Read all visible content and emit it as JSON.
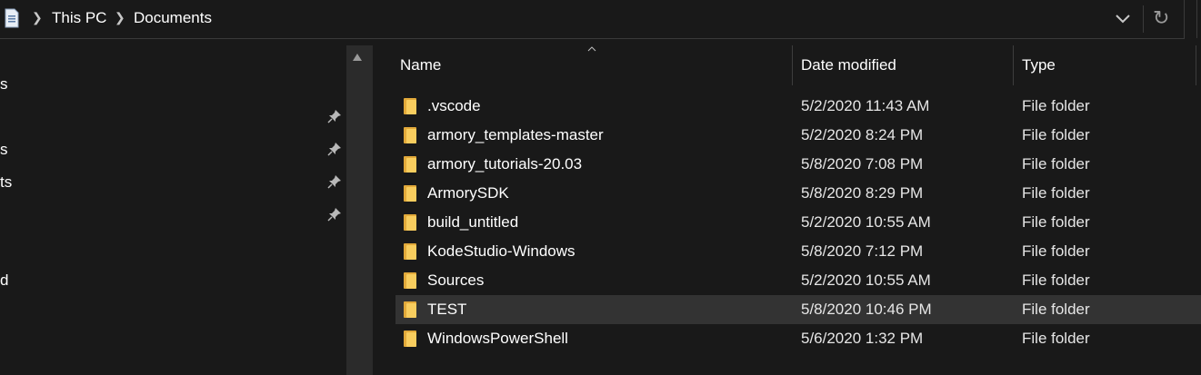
{
  "address_bar": {
    "breadcrumbs": [
      "This PC",
      "Documents"
    ],
    "location_icon": "document-icon",
    "dropdown_icon": "chevron-down-icon",
    "refresh_icon": "refresh-icon",
    "refresh_glyph": "↻"
  },
  "nav_pane": {
    "fragments": [
      {
        "text": "s",
        "pinned": false
      },
      {
        "text": "",
        "pinned": true
      },
      {
        "text": "s",
        "pinned": true
      },
      {
        "text": "ts",
        "pinned": true
      },
      {
        "text": "",
        "pinned": true
      },
      {
        "text": "d",
        "pinned": false
      }
    ],
    "pin_icon": "pin-icon"
  },
  "file_list": {
    "columns": {
      "name": "Name",
      "date": "Date modified",
      "type": "Type"
    },
    "sorted_by": "Name",
    "rows": [
      {
        "name": ".vscode",
        "date": "5/2/2020 11:43 AM",
        "type": "File folder",
        "selected": false
      },
      {
        "name": "armory_templates-master",
        "date": "5/2/2020 8:24 PM",
        "type": "File folder",
        "selected": false
      },
      {
        "name": "armory_tutorials-20.03",
        "date": "5/8/2020 7:08 PM",
        "type": "File folder",
        "selected": false
      },
      {
        "name": "ArmorySDK",
        "date": "5/8/2020 8:29 PM",
        "type": "File folder",
        "selected": false
      },
      {
        "name": "build_untitled",
        "date": "5/2/2020 10:55 AM",
        "type": "File folder",
        "selected": false
      },
      {
        "name": "KodeStudio-Windows",
        "date": "5/8/2020 7:12 PM",
        "type": "File folder",
        "selected": false
      },
      {
        "name": "Sources",
        "date": "5/2/2020 10:55 AM",
        "type": "File folder",
        "selected": false
      },
      {
        "name": "TEST",
        "date": "5/8/2020 10:46 PM",
        "type": "File folder",
        "selected": true
      },
      {
        "name": "WindowsPowerShell",
        "date": "5/6/2020 1:32 PM",
        "type": "File folder",
        "selected": false
      }
    ]
  },
  "colors": {
    "background": "#191919",
    "selected_row": "#333333",
    "folder": "#f8cd5e",
    "folder_back": "#e2a93a"
  }
}
